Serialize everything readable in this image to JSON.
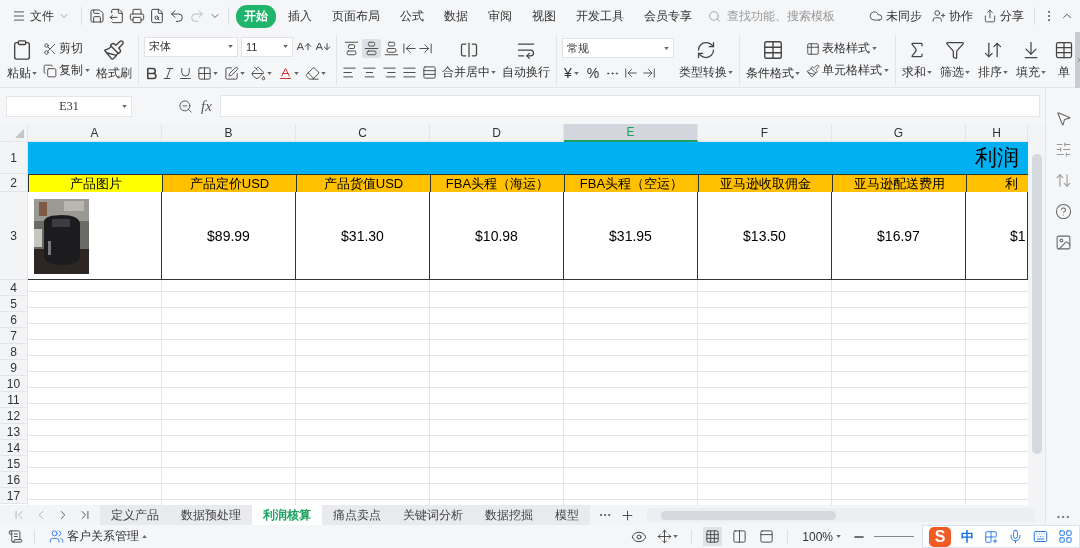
{
  "menu_bar": {
    "file_menu": "文件",
    "tabs": [
      {
        "label": "开始",
        "selected": true
      },
      {
        "label": "插入",
        "selected": false
      },
      {
        "label": "页面布局",
        "selected": false
      },
      {
        "label": "公式",
        "selected": false
      },
      {
        "label": "数据",
        "selected": false
      },
      {
        "label": "审阅",
        "selected": false
      },
      {
        "label": "视图",
        "selected": false
      },
      {
        "label": "开发工具",
        "selected": false
      },
      {
        "label": "会员专享",
        "selected": false
      }
    ],
    "search": {
      "placeholder": "查找功能、搜索模板"
    },
    "actions": [
      {
        "kind": "sync",
        "label": "未同步"
      },
      {
        "kind": "collaborate",
        "label": "协作"
      },
      {
        "kind": "share",
        "label": "分享"
      }
    ]
  },
  "ribbon": {
    "clipboard": {
      "paste": "粘贴",
      "cut": "剪切",
      "copy": "复制",
      "format_painter": "格式刷"
    },
    "font": {
      "font_name": "宋体",
      "font_size": "11"
    },
    "alignment": {
      "vertical_align": [
        {
          "kind": "top",
          "selected": false
        },
        {
          "kind": "middle",
          "selected": true
        },
        {
          "kind": "bottom",
          "selected": false
        }
      ],
      "merge": "合并居中",
      "wrap": "自动换行"
    },
    "number": {
      "format": "常规",
      "currency": "¥",
      "percent": "%",
      "convert": "类型转换"
    },
    "styles": {
      "conditional": "条件格式",
      "table_style": "表格样式",
      "cell_style": "单元格样式"
    },
    "editing": [
      {
        "kind": "sum",
        "label": "求和"
      },
      {
        "kind": "filter",
        "label": "筛选"
      },
      {
        "kind": "sort",
        "label": "排序"
      },
      {
        "kind": "fill",
        "label": "填充"
      },
      {
        "kind": "cell",
        "label": "单"
      }
    ]
  },
  "formula_bar": {
    "cell_name": "E31",
    "fx": "fx"
  },
  "sheet": {
    "columns": [
      {
        "label": "A",
        "selected": false
      },
      {
        "label": "B",
        "selected": false
      },
      {
        "label": "C",
        "selected": false
      },
      {
        "label": "D",
        "selected": false
      },
      {
        "label": "E",
        "selected": true
      },
      {
        "label": "F",
        "selected": false
      },
      {
        "label": "G",
        "selected": false
      },
      {
        "label": "H",
        "selected": false
      }
    ],
    "row_labels": [
      "1",
      "2",
      "3",
      "4",
      "5",
      "6",
      "7",
      "8",
      "9",
      "10",
      "11",
      "12",
      "13",
      "14",
      "15",
      "16",
      "17"
    ],
    "title": "利润",
    "headers": [
      {
        "text": "产品图片",
        "color": "#ffff00"
      },
      {
        "text": "产品定价USD",
        "color": "#ffc000"
      },
      {
        "text": "产品货值USD",
        "color": "#ffc000"
      },
      {
        "text": "FBA头程（海运）",
        "color": "#ffc000"
      },
      {
        "text": "FBA头程（空运）",
        "color": "#ffc000"
      },
      {
        "text": "亚马逊收取佣金",
        "color": "#ffc000"
      },
      {
        "text": "亚马逊配送费用",
        "color": "#ffc000"
      },
      {
        "text": "利",
        "color": "#ffc000"
      }
    ],
    "product_row": {
      "picture": {
        "kind": "picture"
      },
      "values": [
        "$89.99",
        "$31.30",
        "$10.98",
        "$31.95",
        "$13.50",
        "$16.97",
        "$1"
      ]
    }
  },
  "sheet_tabs": [
    {
      "label": "定义产品",
      "selected": false
    },
    {
      "label": "数据预处理",
      "selected": false
    },
    {
      "label": "利润核算",
      "selected": true
    },
    {
      "label": "痛点卖点",
      "selected": false
    },
    {
      "label": "关键词分析",
      "selected": false
    },
    {
      "label": "数据挖掘",
      "selected": false
    },
    {
      "label": "模型",
      "selected": false
    }
  ],
  "status_bar": {
    "app": "客户关系管理",
    "view_modes": [
      {
        "kind": "normal",
        "selected": true
      },
      {
        "kind": "reading",
        "selected": false
      },
      {
        "kind": "page",
        "selected": false
      }
    ],
    "zoom": "100%"
  },
  "ime": {
    "logo": "S",
    "mode": "中"
  }
}
